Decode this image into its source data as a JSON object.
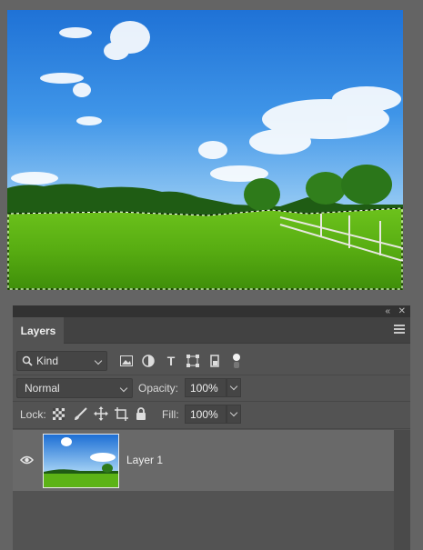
{
  "canvas": {
    "description_icon": "landscape-photo"
  },
  "panel": {
    "topbar_icons": {
      "collapse": "«",
      "close": "✕"
    },
    "tab_label": "Layers",
    "filter": {
      "kind_label": "Kind",
      "kind_icon": "search-icon"
    },
    "filter_icons": [
      "image-filter-icon",
      "adjustment-filter-icon",
      "type-filter-icon",
      "shape-filter-icon",
      "smart-object-filter-icon",
      "toggle-filter-icon"
    ],
    "blend_mode": "Normal",
    "opacity_label": "Opacity:",
    "opacity_value": "100%",
    "lock_label": "Lock:",
    "fill_label": "Fill:",
    "fill_value": "100%",
    "lock_icons": [
      "lock-transparent-pixels-icon",
      "lock-image-pixels-icon",
      "lock-position-icon",
      "lock-artboard-icon",
      "lock-all-icon"
    ],
    "layers": [
      {
        "name": "Layer 1",
        "visible": true
      }
    ]
  },
  "colors": {
    "panel_bg": "#535353",
    "selected_layer": "#696969",
    "workspace": "#646464"
  }
}
